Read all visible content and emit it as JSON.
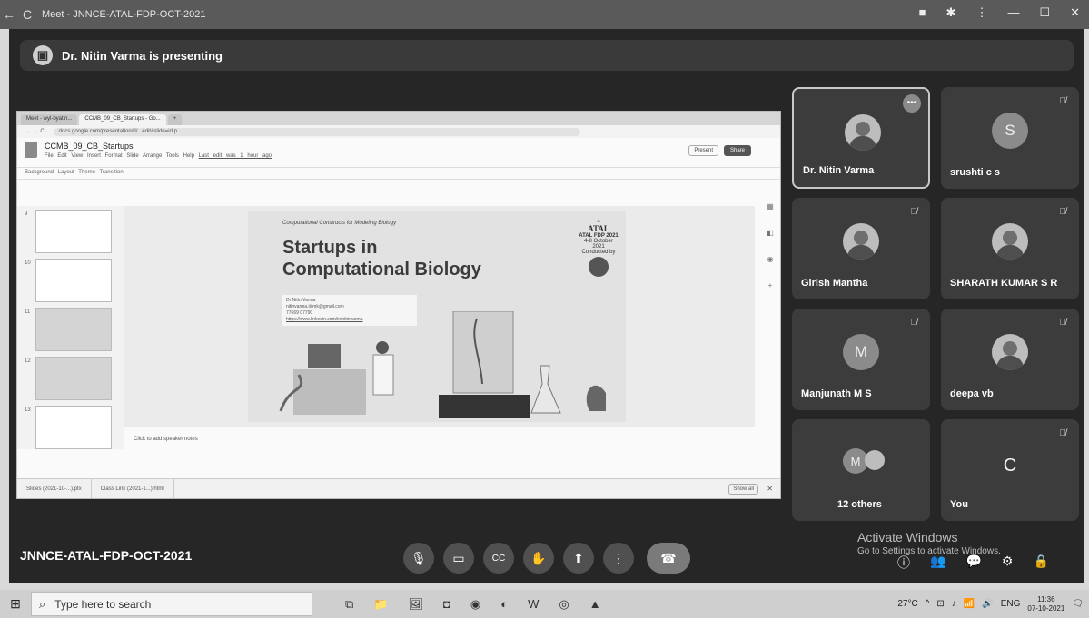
{
  "window": {
    "nav_back": "←",
    "nav_reload": "C",
    "title": "Meet - JNNCE-ATAL-FDP-OCT-2021",
    "controls": [
      "■",
      "✱",
      "⋮",
      "—",
      "☐",
      "✕"
    ]
  },
  "presenting": {
    "text": "Dr. Nitin Varma is presenting"
  },
  "shared_screen": {
    "tabs": [
      "Meet - wyl-byatin...",
      "CCMB_09_CB_Startups - Go..."
    ],
    "tab_new": "+",
    "url": "docs.google.com/presentation/d/...edit#slide=id.p",
    "doc_title": "CCMB_09_CB_Startups",
    "menu": [
      "File",
      "Edit",
      "View",
      "Insert",
      "Format",
      "Slide",
      "Arrange",
      "Tools",
      "Help"
    ],
    "last_edit": "Last edit was 1 hour ago",
    "present_label": "Present",
    "share_label": "Share",
    "toolbar_items": [
      "Background",
      "Layout",
      "Theme",
      "Transition"
    ],
    "slide_numbers": [
      "9",
      "10",
      "11",
      "12",
      "13"
    ],
    "slide": {
      "subtitle": "Computational Constructs for Modeling Biology",
      "title_line1": "Startups in",
      "title_line2": "Computational Biology",
      "contact_name": "Dr Nitin Varma",
      "contact_email": "nitinvarma.iiitmk@gmail.com",
      "contact_phone": "77669 07790",
      "contact_link": "https://www.linkedin.com/in/nitinvarma",
      "atal_name": "ATAL",
      "atal_fdp": "ATAL FDP 2021",
      "atal_dates": "4-8 October 2021",
      "conducted_by": "Conducted by"
    },
    "speaker_notes": "Click to add speaker notes",
    "downloads": [
      "Slides (2021-10-...).ptx",
      "Class Link (2021-1...).html"
    ],
    "show_all": "Show all",
    "dl_close": "✕"
  },
  "participants": [
    {
      "name": "Dr. Nitin Varma",
      "avatar": "photo",
      "muted": false,
      "active": true
    },
    {
      "name": "srushti c s",
      "avatar": "S",
      "muted": true,
      "active": false
    },
    {
      "name": "Girish Mantha",
      "avatar": "photo",
      "muted": true,
      "active": false
    },
    {
      "name": "SHARATH KUMAR S R",
      "avatar": "photo",
      "muted": true,
      "active": false
    },
    {
      "name": "Manjunath M S",
      "avatar": "M",
      "muted": true,
      "active": false
    },
    {
      "name": "deepa vb",
      "avatar": "photo",
      "muted": true,
      "active": false
    },
    {
      "name": "12 others",
      "avatar": "M",
      "muted": false,
      "active": false
    },
    {
      "name": "You",
      "avatar": "C",
      "muted": true,
      "active": false
    }
  ],
  "more_icon": "•••",
  "mute_icon": "🎙̸",
  "meeting_code": "JNNCE-ATAL-FDP-OCT-2021",
  "controls": {
    "mic": "🎙",
    "camera": "▭",
    "captions": "CC",
    "hand": "✋",
    "present": "⬆",
    "more": "⋮",
    "leave": "☎"
  },
  "watermark": {
    "line1": "Activate Windows",
    "line2": "Go to Settings to activate Windows."
  },
  "right_icons": [
    "ⓘ",
    "👥",
    "💬",
    "⚙",
    "🔒"
  ],
  "taskbar": {
    "start_icon": "⊞",
    "search_placeholder": "Type here to search",
    "search_icon": "⌕",
    "temperature": "27°C",
    "language": "ENG",
    "time": "11:36",
    "date": "07-10-2021",
    "icons": [
      "task-view-icon",
      "file-explorer-icon",
      "photos-icon",
      "camera-icon",
      "chrome-icon",
      "edge-icon",
      "word-icon",
      "app-icon",
      "image-viewer-icon"
    ],
    "icon_glyphs": [
      "⧉",
      "📁",
      "🖼",
      "◘",
      "◉",
      "◐",
      "W",
      "◎",
      "▲"
    ],
    "tray_icons": [
      "^",
      "⊡",
      "♪",
      "📶",
      "🔊"
    ],
    "notification": "🗨"
  },
  "colors": {
    "meet_bg": "#262626",
    "tile_bg": "#3c3c3c",
    "taskbar_bg": "#cfcfcf"
  }
}
